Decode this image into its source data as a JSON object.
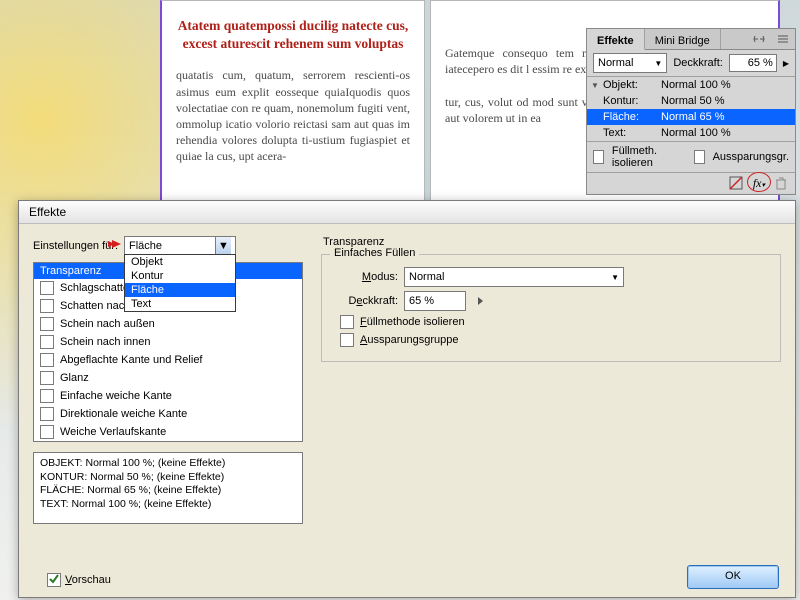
{
  "doc": {
    "red_heading": "Atatem quatempossi ducilig natecte cus, excest aturescit rehenem sum voluptas",
    "left_body": "quatatis cum, quatum, serrorem rescienti-os asimus eum explit eosseque quiaIquodis quos volectatiae con re quam, nonemolum fugiti vent, ommolup icatio volorio reictasi sam aut quas im rehendia volores dolupta ti-ustium fugiaspiet et quiae la cus, upt acera-",
    "right_body": "Gatemque consequo tem maximin rero il inctius p coreser iatecepero es dit l essim re expel id quis et,\n\ntur, cus, volut od mod sunt veleseq uatio. Nam eumqui doloratur aut volorem ut in ea"
  },
  "panel": {
    "tabs": {
      "effekte": "Effekte",
      "mini_bridge": "Mini Bridge"
    },
    "mode_label": "Normal",
    "deckkraft_label": "Deckkraft:",
    "deckkraft_value": "65 %",
    "rows": [
      {
        "label": "Objekt:",
        "value": "Normal 100 %",
        "sel": false,
        "tri": true
      },
      {
        "label": "Kontur:",
        "value": "Normal 50 %",
        "sel": false,
        "tri": false
      },
      {
        "label": "Fläche:",
        "value": "Normal 65 %",
        "sel": true,
        "tri": false
      },
      {
        "label": "Text:",
        "value": "Normal 100 %",
        "sel": false,
        "tri": false
      }
    ],
    "foot": {
      "isolate": "Füllmeth. isolieren",
      "knockout": "Aussparungsgr."
    }
  },
  "dialog": {
    "title": "Effekte",
    "settings_label": "Einstellungen für:",
    "dd_value": "Fläche",
    "dd_options": [
      "Objekt",
      "Kontur",
      "Fläche",
      "Text"
    ],
    "fx_items": [
      "Transparenz",
      "Schlagschatten",
      "Schatten nach innen",
      "Schein nach außen",
      "Schein nach innen",
      "Abgeflachte Kante und Relief",
      "Glanz",
      "Einfache weiche Kante",
      "Direktionale weiche Kante",
      "Weiche Verlaufskante"
    ],
    "summary": [
      "OBJEKT: Normal 100 %; (keine Effekte)",
      "KONTUR: Normal 50 %; (keine Effekte)",
      "FLÄCHE: Normal 65 %; (keine Effekte)",
      "TEXT: Normal 100 %; (keine Effekte)"
    ],
    "preview": "Vorschau",
    "right_title": "Transparenz",
    "fieldset": "Einfaches Füllen",
    "modus_label": "Modus:",
    "modus_value": "Normal",
    "deckkraft_label": "Deckkraft:",
    "deckkraft_value": "65 %",
    "chk_isolate": "Füllmethode isolieren",
    "chk_knockout": "Aussparungsgruppe",
    "ok": "OK"
  }
}
